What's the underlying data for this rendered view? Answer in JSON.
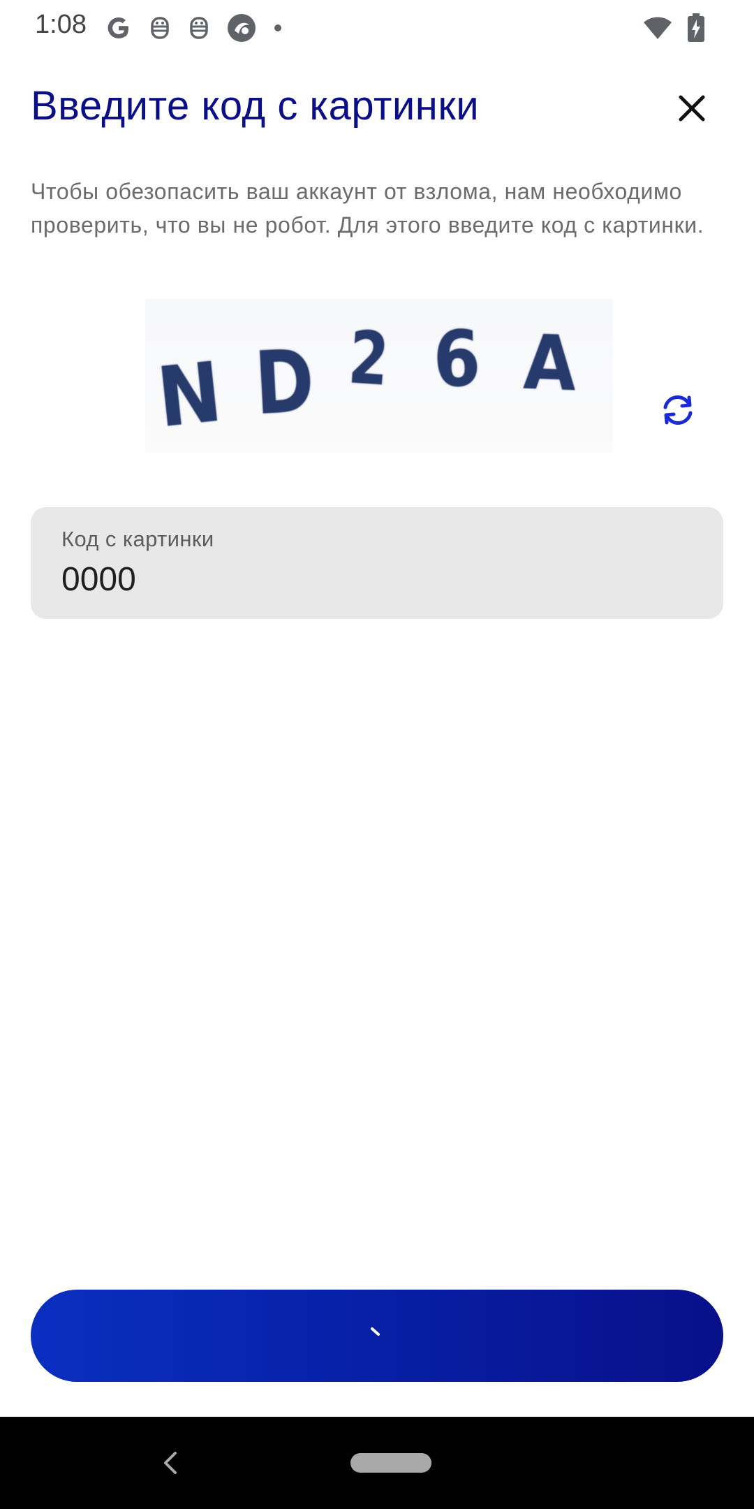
{
  "status_bar": {
    "time": "1:08",
    "left_icons": [
      "google-icon",
      "bot-icon",
      "bot-icon",
      "app-icon",
      "dot-icon"
    ],
    "right_icons": [
      "wifi-icon",
      "battery-charging-icon"
    ]
  },
  "dialog": {
    "title": "Введите код с картинки",
    "description": "Чтобы обезопасить ваш аккаунт от взлома, нам необходимо проверить, что вы не робот. Для этого введите код с картинки.",
    "captcha_text": "ND26A",
    "captcha_chars": [
      "N",
      "D",
      "2",
      "6",
      "A"
    ],
    "input": {
      "label": "Код с картинки",
      "value": "0000"
    }
  },
  "colors": {
    "title": "#0a0f87",
    "accent": "#1a2bd6",
    "button_gradient_start": "#0a2fc1",
    "button_gradient_end": "#08108a"
  }
}
